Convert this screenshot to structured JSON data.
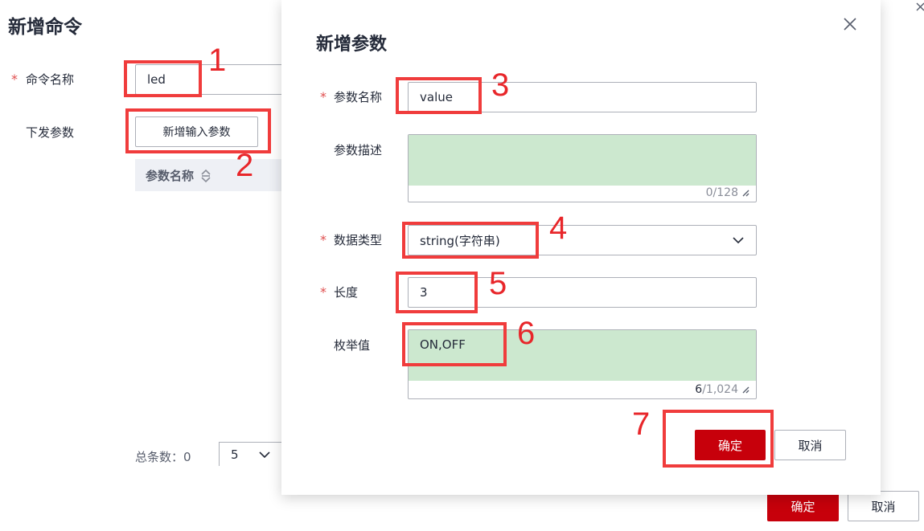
{
  "back_page": {
    "title": "新增命令",
    "command_name_label": "命令名称",
    "command_name_value": "led",
    "params_label": "下发参数",
    "add_param_button": "新增输入参数",
    "table_header_param_name": "参数名称",
    "total_label": "总条数：0",
    "page_size_value": "5",
    "confirm_button": "确定",
    "cancel_button": "取消"
  },
  "dialog": {
    "title": "新增参数",
    "param_name_label": "参数名称",
    "param_name_value": "value",
    "desc_label": "参数描述",
    "desc_value": "",
    "desc_count": "0/128",
    "data_type_label": "数据类型",
    "data_type_value": "string(字符串)",
    "length_label": "长度",
    "length_value": "3",
    "enum_label": "枚举值",
    "enum_value": "ON,OFF",
    "enum_count_current": "6",
    "enum_count_max": "/1,024",
    "confirm_button": "确定",
    "cancel_button": "取消"
  },
  "annotations": [
    "1",
    "2",
    "3",
    "4",
    "5",
    "6",
    "7"
  ],
  "colors": {
    "primary": "#c7000b",
    "highlight": "#f03c3c",
    "required": "#e04e4e",
    "textarea_fill": "#cce8cf"
  }
}
